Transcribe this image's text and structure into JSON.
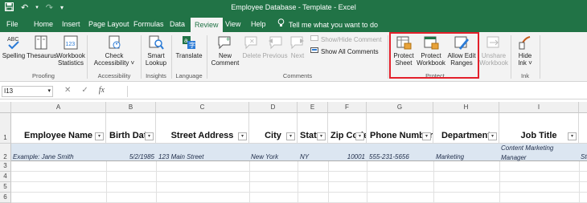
{
  "titlebar": {
    "title": "Employee Database - Template  -  Excel",
    "qat": [
      "save-icon",
      "undo-icon",
      "redo-icon",
      "customize-icon"
    ]
  },
  "tabs": [
    "File",
    "Home",
    "Insert",
    "Page Layout",
    "Formulas",
    "Data",
    "Review",
    "View",
    "Help"
  ],
  "active_tab": "Review",
  "tell_me": "Tell me what you want to do",
  "ribbon": {
    "proofing": {
      "spelling": "Spelling",
      "thesaurus": "Thesaurus",
      "workbook_stats_1": "Workbook",
      "workbook_stats_2": "Statistics",
      "label": "Proofing"
    },
    "accessibility": {
      "check_1": "Check",
      "check_2": "Accessibility ˅",
      "label": "Accessibility"
    },
    "insights": {
      "smart_1": "Smart",
      "smart_2": "Lookup",
      "label": "Insights"
    },
    "language": {
      "translate": "Translate",
      "label": "Language"
    },
    "comments": {
      "new_1": "New",
      "new_2": "Comment",
      "delete": "Delete",
      "previous": "Previous",
      "next": "Next",
      "show_hide": "Show/Hide Comment",
      "show_all": "Show All Comments",
      "label": "Comments"
    },
    "protect": {
      "sheet_1": "Protect",
      "sheet_2": "Sheet",
      "workbook_1": "Protect",
      "workbook_2": "Workbook",
      "ranges_1": "Allow Edit",
      "ranges_2": "Ranges",
      "unshare_1": "Unshare",
      "unshare_2": "Workbook",
      "label": "Protect"
    },
    "ink": {
      "hide_1": "Hide",
      "hide_2": "Ink ˅",
      "label": "Ink"
    }
  },
  "formula_bar": {
    "name_box": "I13",
    "value": ""
  },
  "columns": [
    "A",
    "B",
    "C",
    "D",
    "E",
    "F",
    "G",
    "H",
    "I"
  ],
  "rows": [
    "1",
    "2",
    "3",
    "4",
    "5",
    "6"
  ],
  "headers": [
    "Employee Name",
    "Birth Date",
    "Street Address",
    "City",
    "State",
    "Zip Code",
    "Phone Number",
    "Department",
    "Job Title"
  ],
  "example_row": {
    "name": "Example: Jane Smith",
    "birth_date": "5/2/1985",
    "street": "123 Main Street",
    "city": "New York",
    "state": "NY",
    "zip": "10001",
    "phone": "555-231-5656",
    "department": "Marketing",
    "job_title_1": "Content Marketing",
    "job_title_2": "Manager",
    "overflow": "Ste"
  },
  "colors": {
    "accent": "#217346",
    "highlight": "#e3202b",
    "row_fill": "#dce6f1"
  }
}
